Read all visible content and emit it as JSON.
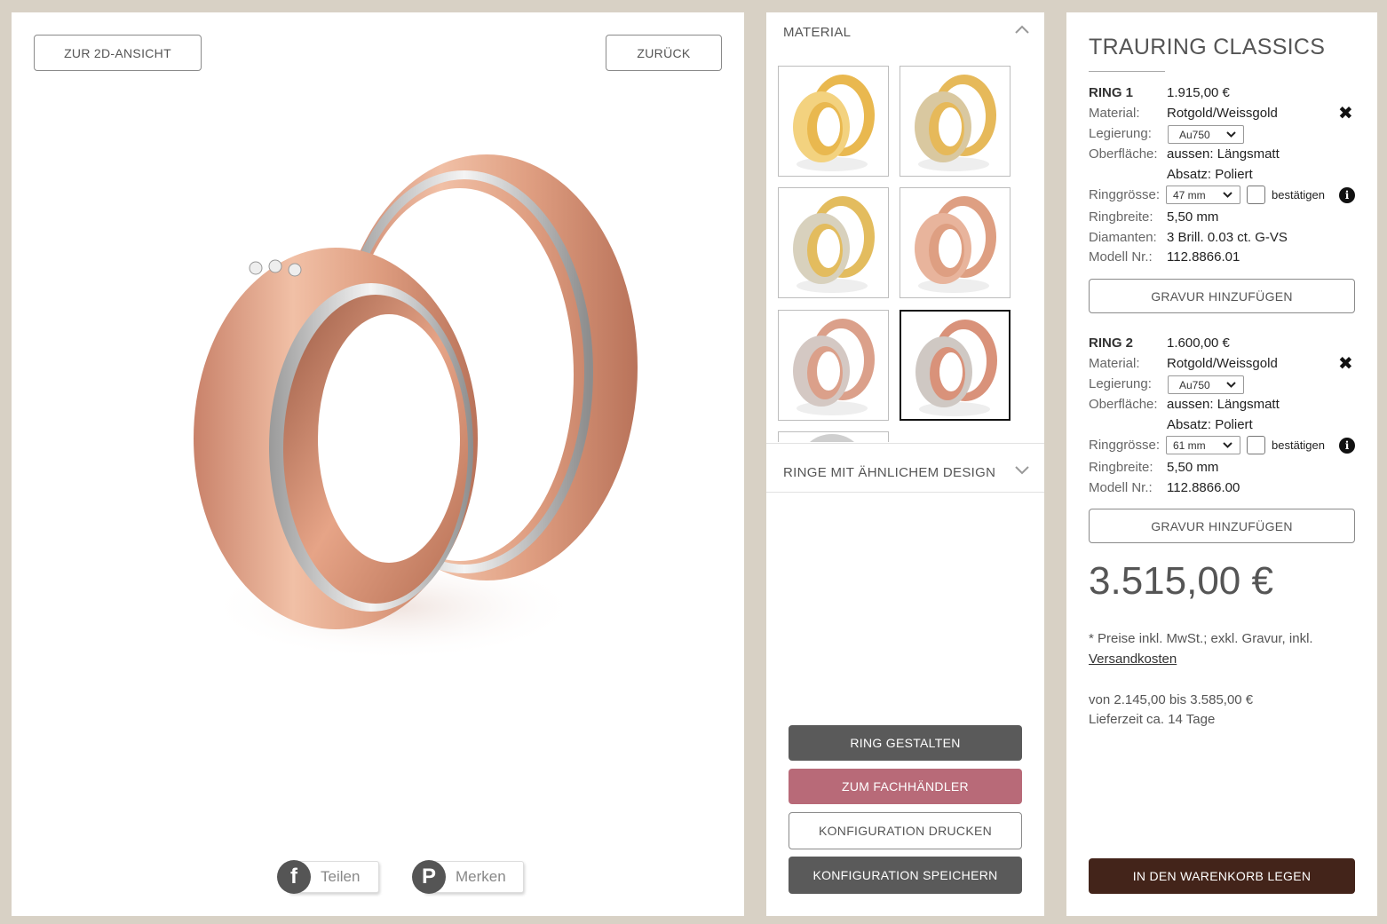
{
  "viewer": {
    "view_2d_label": "ZUR 2D-ANSICHT",
    "back_label": "ZURÜCK",
    "share_label": "Teilen",
    "pin_label": "Merken",
    "facebook_glyph": "f",
    "pinterest_glyph": "P"
  },
  "config": {
    "material_heading": "MATERIAL",
    "similar_heading": "RINGE MIT ÄHNLICHEM DESIGN",
    "swatches": [
      {
        "name": "yellow-white",
        "outer": "#e9b84f",
        "inner": "#f3d27f"
      },
      {
        "name": "yellow-yellow",
        "outer": "#e6b95a",
        "inner": "#d9c8a0"
      },
      {
        "name": "yellow-white-2",
        "outer": "#e3bc5e",
        "inner": "#d8d1bd"
      },
      {
        "name": "rose-rose",
        "outer": "#de9f82",
        "inner": "#e8b49c"
      },
      {
        "name": "rose-white",
        "outer": "#dba08a",
        "inner": "#d4c8c3"
      },
      {
        "name": "rose-white-selected",
        "outer": "#d9927a",
        "inner": "#cfc8c3"
      }
    ],
    "design_label": "RING GESTALTEN",
    "dealer_label": "ZUM FACHHÄNDLER",
    "print_label": "KONFIGURATION DRUCKEN",
    "save_label": "KONFIGURATION SPEICHERN",
    "colors": {
      "dark": "#5a5a5a",
      "dealer": "#b86a78"
    }
  },
  "summary": {
    "title": "TRAURING CLASSICS",
    "labels": {
      "material": "Material:",
      "alloy": "Legierung:",
      "surface": "Oberfläche:",
      "size": "Ringgrösse:",
      "width": "Ringbreite:",
      "diamonds": "Diamanten:",
      "model": "Modell Nr.:",
      "confirm": "bestätigen",
      "engraving": "GRAVUR HINZUFÜGEN"
    },
    "ring1": {
      "name": "RING 1",
      "price": "1.915,00 €",
      "material": "Rotgold/Weissgold",
      "alloy": "Au750",
      "surface_outer": "aussen: Längsmatt",
      "surface_edge": "Absatz: Poliert",
      "size": "47 mm",
      "width": "5,50 mm",
      "diamonds": "3 Brill. 0.03 ct. G-VS",
      "model": "112.8866.01"
    },
    "ring2": {
      "name": "RING 2",
      "price": "1.600,00 €",
      "material": "Rotgold/Weissgold",
      "alloy": "Au750",
      "surface_outer": "aussen: Längsmatt",
      "surface_edge": "Absatz: Poliert",
      "size": "61 mm",
      "width": "5,50 mm",
      "model": "112.8866.00"
    },
    "total": "3.515,00 €",
    "tax_note": "* Preise inkl. MwSt.; exkl. Gravur, inkl.",
    "shipping_link": "Versandkosten",
    "range": "von 2.145,00 bis 3.585,00 €",
    "delivery": "Lieferzeit ca. 14 Tage",
    "cart_label": "IN DEN WARENKORB LEGEN",
    "cart_color": "#43241a",
    "close_glyph": "✖",
    "info_glyph": "i"
  }
}
